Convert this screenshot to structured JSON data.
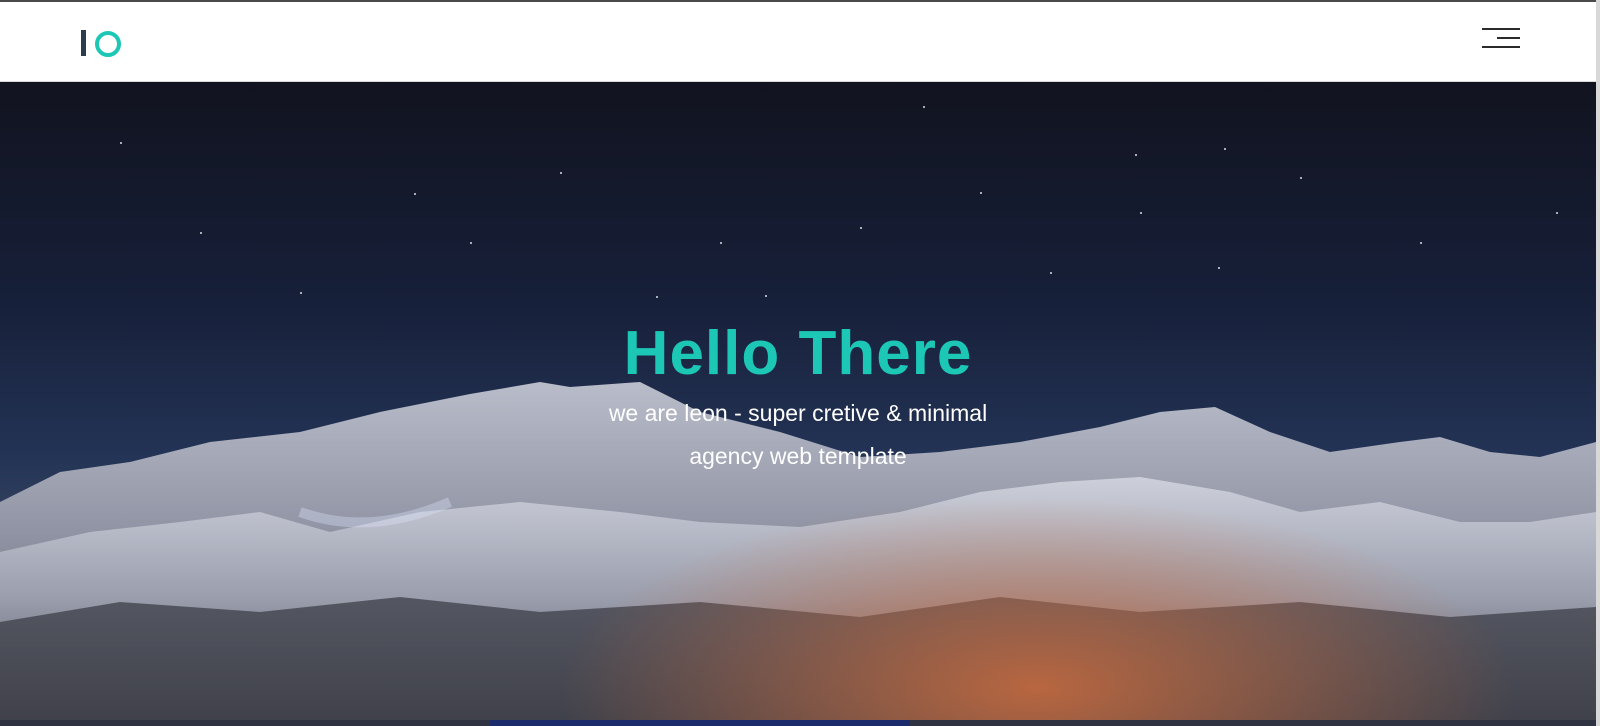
{
  "header": {
    "logo_icon": "io-logo",
    "menu_icon": "hamburger-menu-icon"
  },
  "hero": {
    "title": "Hello There",
    "subtitle_line1": "we are leon - super cretive & minimal",
    "subtitle_line2": "agency web template"
  },
  "colors": {
    "accent": "#1cc7b6",
    "logo_dark": "#2d3e4b",
    "header_bg": "#ffffff",
    "hero_text": "#ffffff"
  }
}
